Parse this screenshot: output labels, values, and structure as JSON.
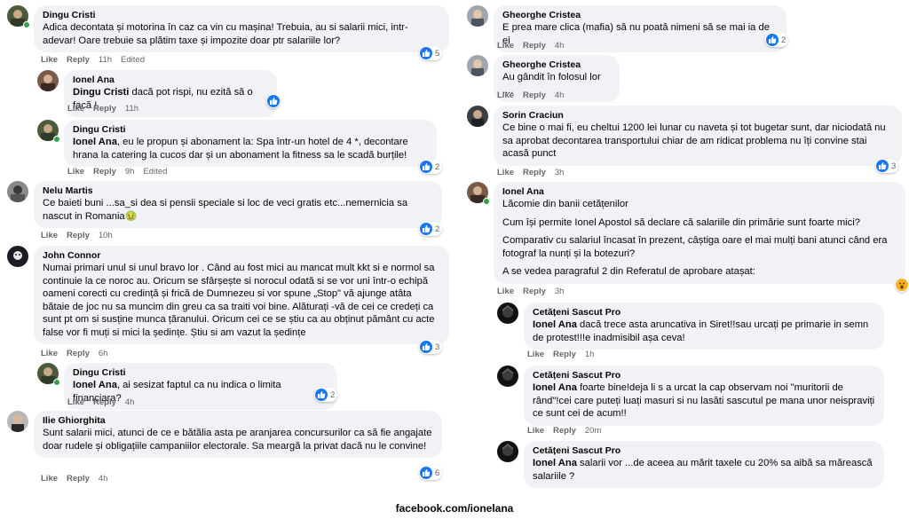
{
  "actions": {
    "like": "Like",
    "reply": "Reply",
    "edited": "Edited"
  },
  "colors": {
    "bubble": "#f0f2f5",
    "like_blue": "#1877f2",
    "meta_gray": "#65676b",
    "online_green": "#31a24c",
    "wow_yellow": "#f7b125"
  },
  "left": [
    {
      "author": "Dingu Cristi",
      "mention": "",
      "text": "Adica decontata și motorina în caz ca vin cu mașina! Trebuia, au si salarii mici, intr-adevar! Oare trebuie sa plătim taxe și impozite doar ptr salariile lor?",
      "time": "11h",
      "edited": "Edited",
      "reactions": "5"
    },
    {
      "author": "Ionel Ana",
      "mention": "Dingu Cristi",
      "text": "dacă pot rispi, nu ezită să o facă !",
      "time": "11h",
      "edited": "",
      "reactions": ""
    },
    {
      "author": "Dingu Cristi",
      "mention": "Ionel Ana",
      "text": ", eu le propun și abonament la: Spa într-un hotel de 4 *, decontare hrana la catering la cucos dar și un abonament la fitness sa le scadă burțile!",
      "time": "9h",
      "edited": "Edited",
      "reactions": "2"
    },
    {
      "author": "Nelu Martis",
      "mention": "",
      "text": "Ce baieti buni ...sa_si dea si pensii speciale si loc de veci gratis etc...nemernicia sa nascut in Romania🤢",
      "time": "10h",
      "edited": "",
      "reactions": "2"
    },
    {
      "author": "John Connor",
      "mention": "",
      "text": "Numai primari unul si unul bravo lor . Când au fost mici au mancat mult kkt si e normol sa continuie la ce noroc au. Oricum se sfârșește si norocul odată si se vor uni într-o echipă oameni corecti cu credință și frică de Dumnezeu si vor spune „Stop\" vă ajunge atâta bătaie de joc nu sa muncim din greu ca sa traiti voi bine. Alăturați -vă de cei ce credeți ca sunt pt om si susține munca țăranului. Oricum cei ce se știu ca au obținut pământ cu acte false vor fi muți si mici la ședințe. Știu si am vazut la ședințe",
      "time": "6h",
      "edited": "",
      "reactions": "3"
    },
    {
      "author": "Dingu Cristi",
      "mention": "Ionel Ana",
      "text": ", ai sesizat faptul ca nu indica o limita financiara?",
      "time": "4h",
      "edited": "",
      "reactions": "2"
    },
    {
      "author": "Ilie Ghiorghita",
      "mention": "",
      "text": "Sunt salarii mici, atunci de ce e bătălia asta pe aranjarea concursurilor ca să fie angajate doar rudele și obligațiile campaniilor electorale. Sa meargă la privat dacă nu le convine!",
      "time": "4h",
      "edited": "",
      "reactions": "6"
    }
  ],
  "right": [
    {
      "author": "Gheorghe Cristea",
      "mention": "",
      "text": "E prea mare clica (mafia) să nu poată nimeni să se mai ia de ei",
      "time": "4h",
      "edited": "",
      "reactions": "2"
    },
    {
      "author": "Gheorghe Cristea",
      "mention": "",
      "text": "Au gândit în folosul lor ....",
      "time": "4h",
      "edited": "",
      "reactions": ""
    },
    {
      "author": "Sorin Craciun",
      "mention": "",
      "text": "Ce bine o mai fi, eu cheltui 1200 lei lunar cu naveta și tot bugetar sunt, dar niciodată nu sa aprobat decontarea transportului chiar de am ridicat problema nu îți convine stai acasă punct",
      "time": "3h",
      "edited": "",
      "reactions": "3"
    },
    {
      "author": "Ionel Ana",
      "mention": "",
      "paragraphs": [
        "Lăcomie din banii cetățenilor",
        "Cum își permite Ionel Apostol să declare că salariile din primărie sunt foarte mici?",
        "Comparativ cu salariul încasat în prezent, câștiga oare el mai mulți bani atunci când era fotograf la nunți și la botezuri?",
        "A se vedea paragraful 2 din Referatul de aprobare atașat:"
      ],
      "time": "3h",
      "edited": "",
      "reactions": "wow"
    },
    {
      "author": "Cetățeni Sascut Pro",
      "mention": "Ionel Ana",
      "text": "dacă trece asta aruncativa in Siret!!sau urcați pe primarie in semn de protest!!!e inadmisibil așa ceva!",
      "time": "1h",
      "edited": "",
      "reactions": ""
    },
    {
      "author": "Cetățeni Sascut Pro",
      "mention": "Ionel Ana",
      "text": "foarte bine!deja li s a urcat la cap observam noi \"muritorii de rând\"!cei care puteți luați masuri si nu lasăti sascutul pe mana unor neispraviți ce sunt cei de acum!!",
      "time": "20m",
      "edited": "",
      "reactions": ""
    },
    {
      "author": "Cetățeni Sascut Pro",
      "mention": "Ionel Ana",
      "text": "salarii vor ...de aceea au mărit taxele cu 20% sa aibă sa mărească salariile ?",
      "time": "",
      "edited": "",
      "reactions": ""
    }
  ],
  "footer": "facebook.com/ionelana"
}
